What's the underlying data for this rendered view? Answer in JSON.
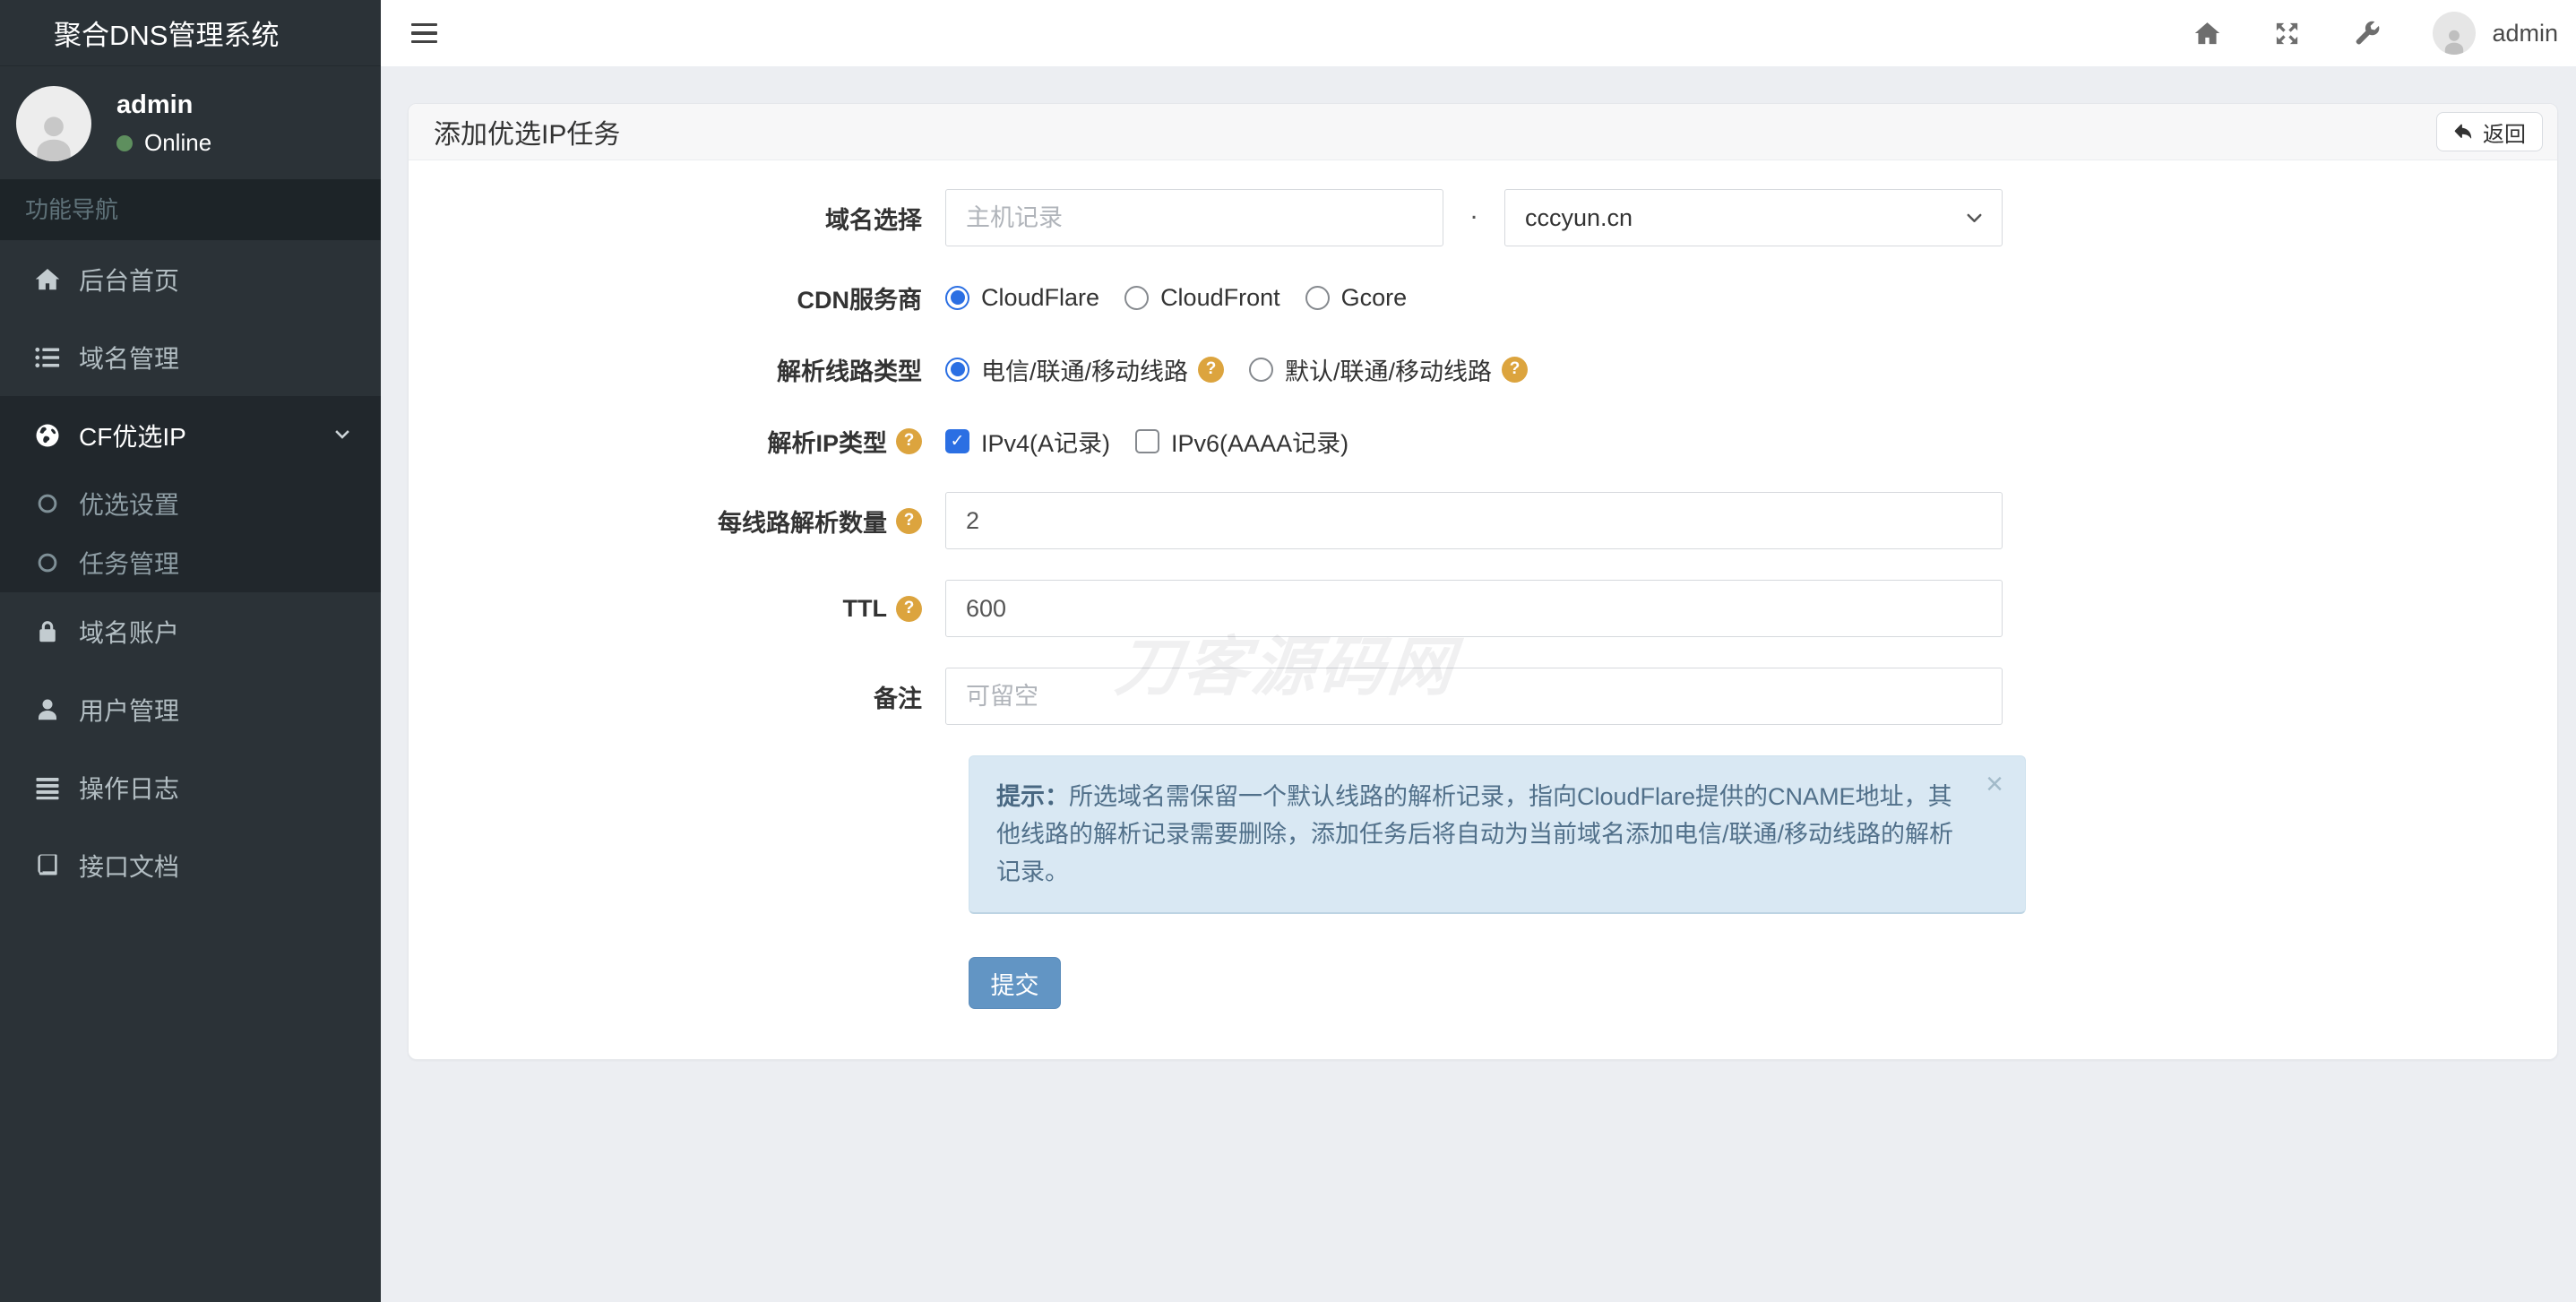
{
  "brand": "聚合DNS管理系统",
  "user": {
    "name": "admin",
    "status": "Online"
  },
  "sidebar": {
    "section_label": "功能导航",
    "menu": [
      {
        "label": "后台首页"
      },
      {
        "label": "域名管理"
      },
      {
        "label": "CF优选IP",
        "children": [
          {
            "label": "优选设置"
          },
          {
            "label": "任务管理"
          }
        ]
      },
      {
        "label": "域名账户"
      },
      {
        "label": "用户管理"
      },
      {
        "label": "操作日志"
      },
      {
        "label": "接口文档"
      }
    ]
  },
  "topbar": {
    "username": "admin"
  },
  "panel": {
    "title": "添加优选IP任务",
    "back_label": "返回"
  },
  "form": {
    "help_icon": "?",
    "domain": {
      "label": "域名选择",
      "host_placeholder": "主机记录",
      "separator": ".",
      "selected_domain": "cccyun.cn"
    },
    "cdn": {
      "label": "CDN服务商",
      "options": [
        {
          "label": "CloudFlare"
        },
        {
          "label": "CloudFront"
        },
        {
          "label": "Gcore"
        }
      ],
      "selected": "CloudFlare"
    },
    "line_type": {
      "label": "解析线路类型",
      "options": [
        {
          "label": "电信/联通/移动线路"
        },
        {
          "label": "默认/联通/移动线路"
        }
      ],
      "selected": "电信/联通/移动线路"
    },
    "ip_type": {
      "label": "解析IP类型",
      "options": [
        {
          "label": "IPv4(A记录)",
          "checked": true
        },
        {
          "label": "IPv6(AAAA记录)",
          "checked": false
        }
      ],
      "check_glyph": "✓"
    },
    "per_line": {
      "label": "每线路解析数量",
      "value": "2"
    },
    "ttl": {
      "label": "TTL",
      "value": "600"
    },
    "remark": {
      "label": "备注",
      "placeholder": "可留空"
    },
    "alert": {
      "prefix": "提示：",
      "text": "所选域名需保留一个默认线路的解析记录，指向CloudFlare提供的CNAME地址，其他线路的解析记录需要删除，添加任务后将自动为当前域名添加电信/联通/移动线路的解析记录。",
      "close": "×"
    },
    "submit_label": "提交"
  },
  "watermark": {
    "text": "刀客源码网"
  },
  "colors": {
    "accent_blue": "#2b6fe3",
    "submit_blue": "#6295c4",
    "help_orange": "#dca43e",
    "online_green": "#5e8f5e",
    "alert_bg": "#d9e8f3",
    "alert_text": "#51708a",
    "sidebar_bg": "#2b3237"
  }
}
